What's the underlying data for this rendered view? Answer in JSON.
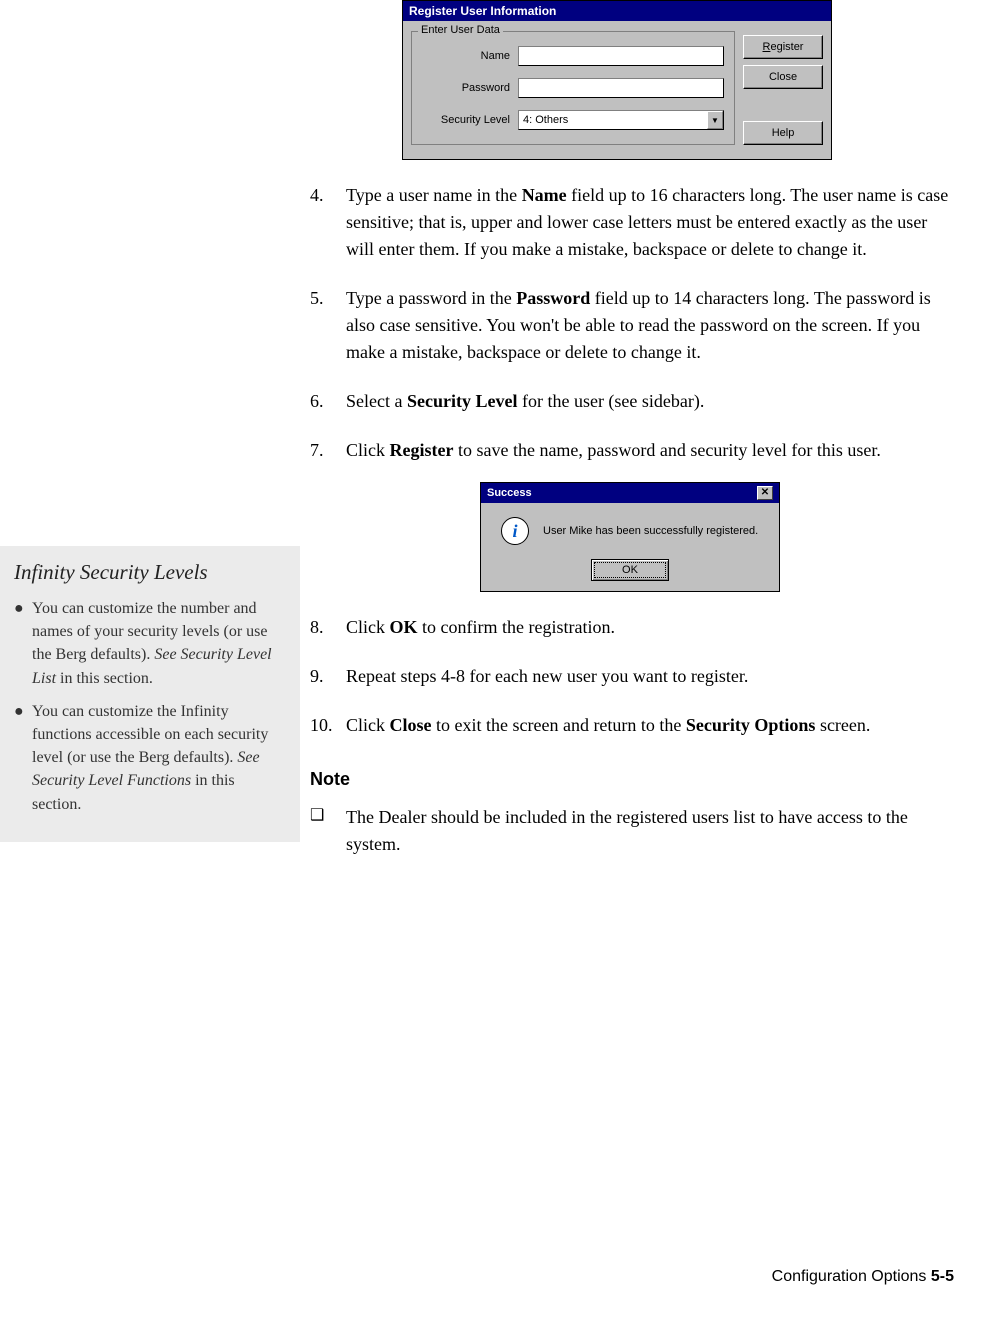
{
  "register_dialog": {
    "title": "Register User Information",
    "legend": "Enter User Data",
    "name_label": "Name",
    "password_label": "Password",
    "security_label": "Security Level",
    "security_value": "4: Others",
    "register_btn_pre": "R",
    "register_btn_post": "egister",
    "close_btn": "Close",
    "help_btn": "Help"
  },
  "steps": {
    "s4_num": "4.",
    "s4_a": "Type a user name in the ",
    "s4_b": "Name",
    "s4_c": " field up to 16 characters long. The user name is case sensitive; that is, upper and lower case letters must be entered exactly as the user will enter them. If you make a mistake, backspace or delete to change it.",
    "s5_num": "5.",
    "s5_a": "Type a password in the ",
    "s5_b": "Password",
    "s5_c": " field up to 14 characters long. The password is also case sensitive. You won't be able to read the password on the screen. If you make a mistake, backspace or delete to change it.",
    "s6_num": "6.",
    "s6_a": "Select a ",
    "s6_b": "Security Level",
    "s6_c": " for the user (see sidebar).",
    "s7_num": "7.",
    "s7_a": "Click ",
    "s7_b": "Register",
    "s7_c": " to save the name, password and security level for this user.",
    "s8_num": "8.",
    "s8_a": "Click ",
    "s8_b": "OK",
    "s8_c": " to confirm the registration.",
    "s9_num": "9.",
    "s9_a": "Repeat steps 4-8 for each new user you want to register.",
    "s10_num": "10.",
    "s10_a": "Click ",
    "s10_b": "Close",
    "s10_c": " to exit the screen and return to the ",
    "s10_d": "Security Options",
    "s10_e": " screen."
  },
  "success_dialog": {
    "title": "Success",
    "message": "User Mike has been successfully registered.",
    "ok": "OK"
  },
  "note": {
    "heading": "Note",
    "bullet": "❑",
    "text": "The Dealer should be included in the registered users list to have access to the system."
  },
  "sidebar": {
    "heading": "Infinity Security Levels",
    "bullet": "●",
    "item1_a": "You can customize the number and names of your security levels (or use the Berg defaults). ",
    "item1_b": "See Security Level List",
    "item1_c": " in this section.",
    "item2_a": "You can customize the Infinity functions accessible on each security level (or use the Berg defaults). ",
    "item2_b": "See Security Level Functions",
    "item2_c": " in this section."
  },
  "footer": {
    "section": "Configuration Options  ",
    "page": "5-5"
  }
}
